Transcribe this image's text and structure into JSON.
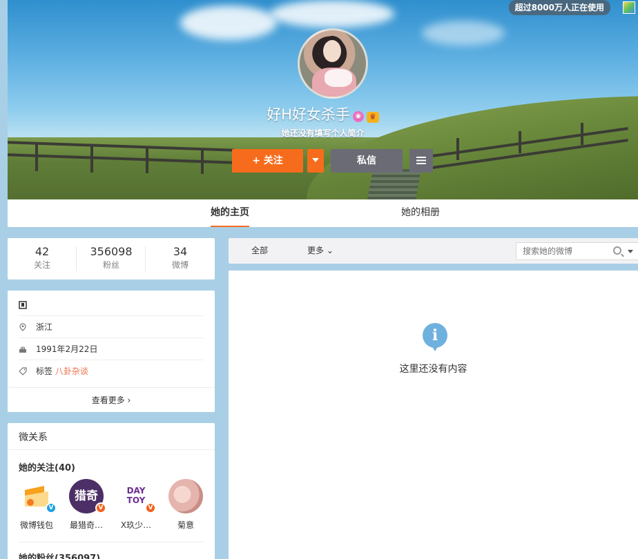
{
  "top_notice": "超过8000万人正在使用",
  "profile": {
    "name": "好H好女杀手",
    "intro": "她还没有填写个人简介"
  },
  "actions": {
    "follow_label": "+ 关注",
    "message_label": "私信"
  },
  "tabs": [
    {
      "label": "她的主页",
      "active": true
    },
    {
      "label": "她的相册",
      "active": false
    }
  ],
  "stats": [
    {
      "value": "42",
      "label": "关注"
    },
    {
      "value": "356098",
      "label": "粉丝"
    },
    {
      "value": "34",
      "label": "微博"
    }
  ],
  "info": {
    "location": "浙江",
    "birthday": "1991年2月22日",
    "tags_label": "标签",
    "tags_value": "八卦杂谈",
    "see_more": "查看更多 ›"
  },
  "relations": {
    "title": "微关系",
    "following_title": "她的关注(40)",
    "following": [
      {
        "name": "微博钱包",
        "badge_color": "#1da1e2"
      },
      {
        "name": "最猎奇…",
        "badge_color": "#f1611d"
      },
      {
        "name": "X玖少…",
        "badge_color": "#f1611d"
      },
      {
        "name": "菊意",
        "badge_color": ""
      }
    ],
    "fans_title": "她的粉丝(356097)"
  },
  "feed": {
    "tab_all": "全部",
    "tab_more": "更多 ⌄",
    "search_placeholder": "搜索她的微博",
    "empty_text": "这里还没有内容"
  },
  "colors": {
    "accent": "#f76c1c",
    "secondary_button": "#6b6b76",
    "page_background": "#a9cfe6",
    "tag_link": "#eb7350",
    "info_icon": "#6fb1de"
  }
}
